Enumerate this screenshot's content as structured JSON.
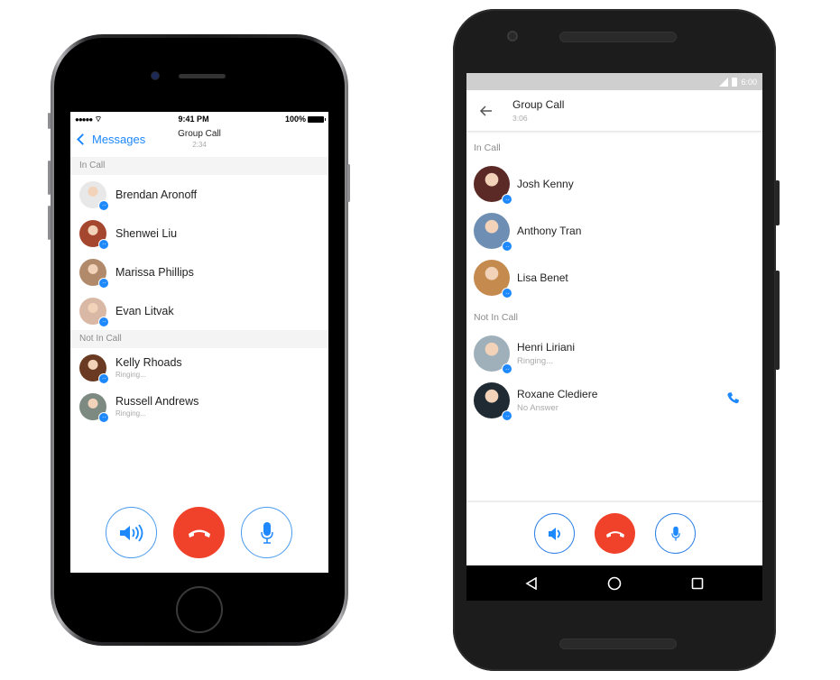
{
  "ios": {
    "status": {
      "signal": "●●●●● ",
      "wifi": "wifi",
      "time": "9:41 PM",
      "battery": "100%"
    },
    "nav": {
      "back_label": "Messages",
      "title": "Group Call",
      "duration": "2:34"
    },
    "sections": [
      {
        "header": "In Call",
        "people": [
          {
            "name": "Brendan Aronoff",
            "status": "",
            "avatar_color": "#e8e8e8"
          },
          {
            "name": "Shenwei Liu",
            "status": "",
            "avatar_color": "#a5472f"
          },
          {
            "name": "Marissa Phillips",
            "status": "",
            "avatar_color": "#b08a6a"
          },
          {
            "name": "Evan Litvak",
            "status": "",
            "avatar_color": "#d9b9a5"
          }
        ]
      },
      {
        "header": "Not In Call",
        "people": [
          {
            "name": "Kelly Rhoads",
            "status": "Ringing...",
            "avatar_color": "#6b3a22"
          },
          {
            "name": "Russell Andrews",
            "status": "Ringing...",
            "avatar_color": "#7d8a82"
          }
        ]
      }
    ],
    "controls": {
      "speaker": "speaker",
      "end": "end-call",
      "mic": "microphone"
    }
  },
  "android": {
    "status": {
      "time": "6:00"
    },
    "toolbar": {
      "title": "Group Call",
      "duration": "3:06"
    },
    "sections": [
      {
        "header": "In Call",
        "people": [
          {
            "name": "Josh Kenny",
            "status": "",
            "avatar_color": "#5b2a26"
          },
          {
            "name": "Anthony Tran",
            "status": "",
            "avatar_color": "#6e8fb3"
          },
          {
            "name": "Lisa Benet",
            "status": "",
            "avatar_color": "#c48a4e"
          }
        ]
      },
      {
        "header": "Not In Call",
        "people": [
          {
            "name": "Henri Liriani",
            "status": "Ringing...",
            "avatar_color": "#9fb0bb",
            "call_button": false
          },
          {
            "name": "Roxane Clediere",
            "status": "No Answer",
            "avatar_color": "#1f2a33",
            "call_button": true
          }
        ]
      }
    ],
    "controls": {
      "speaker": "speaker",
      "end": "end-call",
      "mic": "microphone"
    },
    "navbar": [
      "back",
      "home",
      "recents"
    ]
  },
  "colors": {
    "accent": "#1e88ff",
    "end_call": "#f0412a",
    "section_text": "#8c8c8c"
  }
}
